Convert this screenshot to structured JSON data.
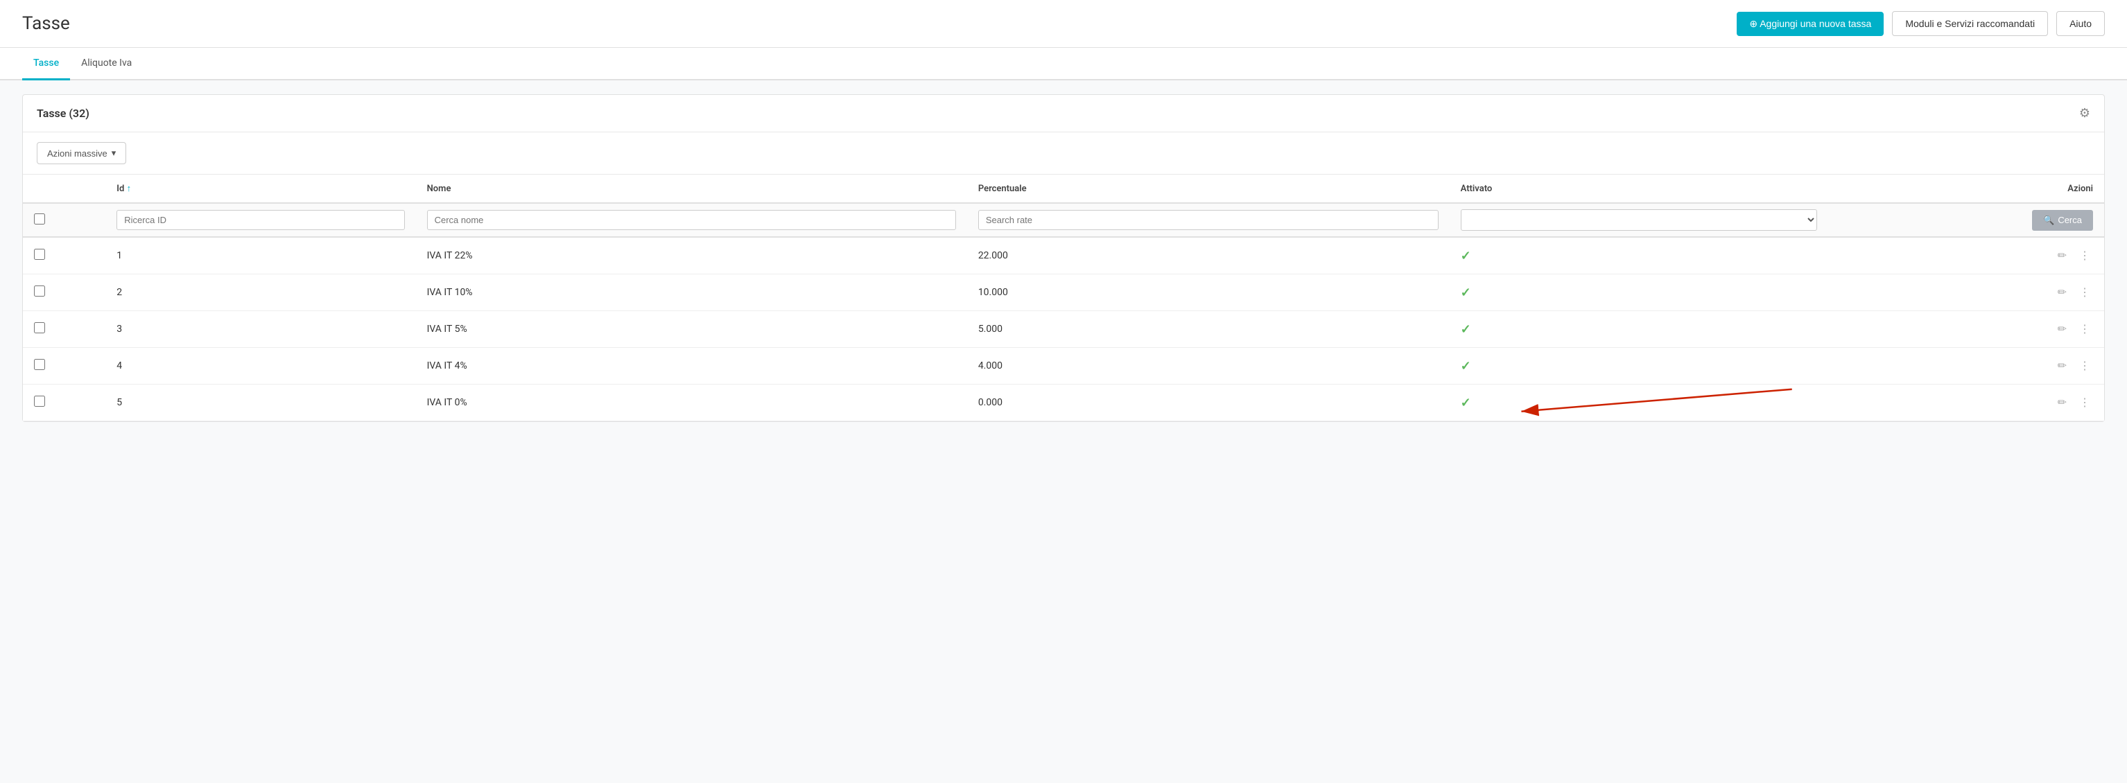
{
  "header": {
    "title": "Tasse",
    "add_button": "⊕ Aggiungi una nuova tassa",
    "modules_button": "Moduli e Servizi raccomandati",
    "help_button": "Aiuto"
  },
  "tabs": [
    {
      "label": "Tasse",
      "active": true
    },
    {
      "label": "Aliquote Iva",
      "active": false
    }
  ],
  "card": {
    "title": "Tasse (32)"
  },
  "toolbar": {
    "bulk_label": "Azioni massive"
  },
  "table": {
    "columns": [
      {
        "label": "Id",
        "sortable": true,
        "sort": "asc"
      },
      {
        "label": "Nome"
      },
      {
        "label": "Percentuale"
      },
      {
        "label": "Attivato"
      },
      {
        "label": "Azioni"
      }
    ],
    "filters": {
      "id_placeholder": "Ricerca ID",
      "name_placeholder": "Cerca nome",
      "rate_placeholder": "Search rate",
      "search_label": "🔍 Cerca"
    },
    "rows": [
      {
        "id": "1",
        "nome": "IVA IT 22%",
        "percentuale": "22.000",
        "attivato": true
      },
      {
        "id": "2",
        "nome": "IVA IT 10%",
        "percentuale": "10.000",
        "attivato": true
      },
      {
        "id": "3",
        "nome": "IVA IT 5%",
        "percentuale": "5.000",
        "attivato": true
      },
      {
        "id": "4",
        "nome": "IVA IT 4%",
        "percentuale": "4.000",
        "attivato": true
      },
      {
        "id": "5",
        "nome": "IVA IT 0%",
        "percentuale": "0.000",
        "attivato": true
      }
    ]
  }
}
